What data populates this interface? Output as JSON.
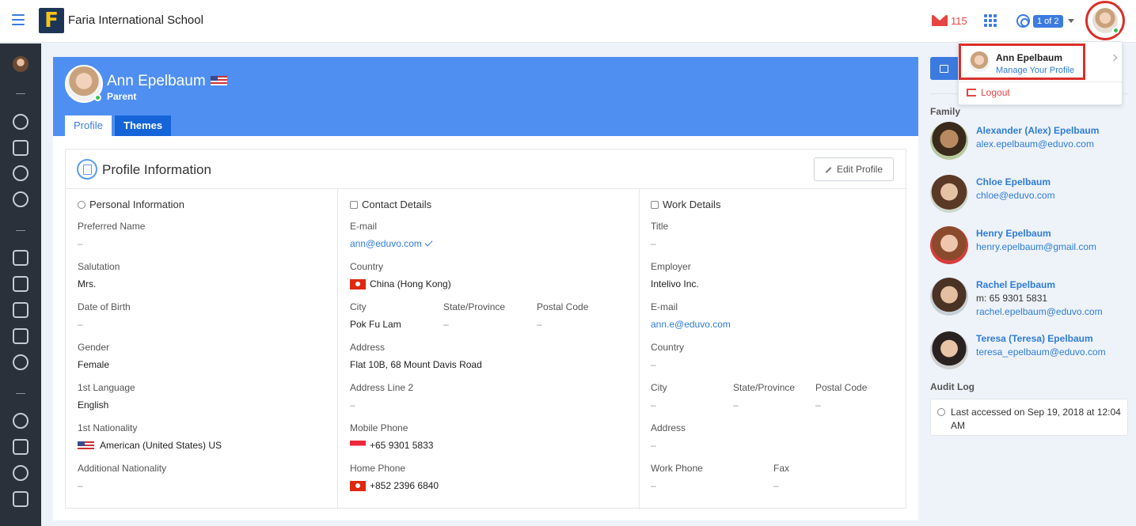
{
  "app": {
    "school_name": "Faria International School",
    "logo_letter": "F"
  },
  "topbar": {
    "mail_count": "115",
    "page_indicator": "1 of 2"
  },
  "profile": {
    "name": "Ann Epelbaum",
    "role": "Parent",
    "flag_icon": "us-flag-icon"
  },
  "tabs": [
    {
      "label": "Profile",
      "active": true
    },
    {
      "label": "Themes",
      "active": false
    }
  ],
  "section": {
    "title": "Profile Information",
    "edit_label": "Edit Profile"
  },
  "personal": {
    "title": "Personal Information",
    "fields": [
      {
        "label": "Preferred Name",
        "value": "–"
      },
      {
        "label": "Salutation",
        "value": "Mrs."
      },
      {
        "label": "Date of Birth",
        "value": "–"
      },
      {
        "label": "Gender",
        "value": "Female"
      },
      {
        "label": "1st Language",
        "value": "English"
      },
      {
        "label": "1st Nationality",
        "value": "American (United States) US"
      },
      {
        "label": "Additional Nationality",
        "value": "–"
      }
    ]
  },
  "contact": {
    "title": "Contact Details",
    "email_label": "E-mail",
    "email": "ann@eduvo.com",
    "country_label": "Country",
    "country": "China (Hong Kong)",
    "city_label": "City",
    "city": "Pok Fu Lam",
    "state_label": "State/Province",
    "state": "–",
    "postal_label": "Postal Code",
    "postal": "–",
    "address_label": "Address",
    "address": "Flat 10B, 68 Mount Davis Road",
    "address2_label": "Address Line 2",
    "address2": "–",
    "mobile_label": "Mobile Phone",
    "mobile": "+65 9301 5833",
    "home_label": "Home Phone",
    "home": "+852 2396 6840"
  },
  "work": {
    "title": "Work Details",
    "title_label": "Title",
    "title_value": "–",
    "employer_label": "Employer",
    "employer": "Intelivo Inc.",
    "email_label": "E-mail",
    "email": "ann.e@eduvo.com",
    "country_label": "Country",
    "country": "–",
    "city_label": "City",
    "city": "–",
    "state_label": "State/Province",
    "state": "–",
    "postal_label": "Postal Code",
    "postal": "–",
    "address_label": "Address",
    "address": "–",
    "phone_label": "Work Phone",
    "phone": "–",
    "fax_label": "Fax",
    "fax": "–"
  },
  "family": {
    "title": "Family",
    "members": [
      {
        "name": "Alexander (Alex) Epelbaum",
        "line1": "alex.epelbaum@eduvo.com"
      },
      {
        "name": "Chloe Epelbaum",
        "line1": "chloe@eduvo.com"
      },
      {
        "name": "Henry Epelbaum",
        "line1": "henry.epelbaum@gmail.com"
      },
      {
        "name": "Rachel Epelbaum",
        "line1": "m: 65 9301 5831",
        "line2": "rachel.epelbaum@eduvo.com"
      },
      {
        "name": "Teresa (Teresa) Epelbaum",
        "line1": "teresa_epelbaum@eduvo.com"
      }
    ]
  },
  "audit": {
    "title": "Audit Log",
    "text": "Last accessed on Sep 19, 2018 at 12:04 AM"
  },
  "dropdown": {
    "name": "Ann Epelbaum",
    "manage": "Manage Your Profile",
    "logout": "Logout"
  },
  "colors": {
    "accent": "#3b7be0",
    "header": "#4f8ff2",
    "danger": "#e64545",
    "sidebar": "#2b313b"
  }
}
